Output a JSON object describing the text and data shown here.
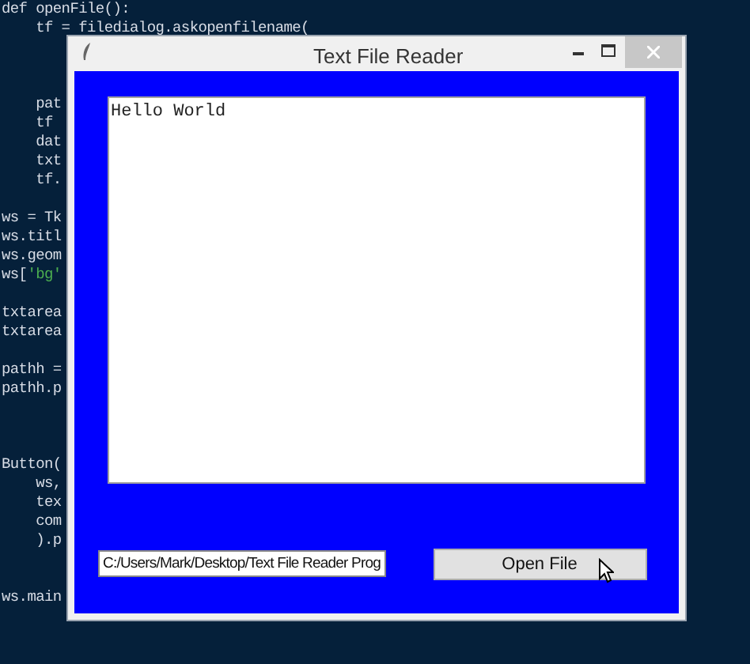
{
  "editor": {
    "lines": [
      {
        "text": "def openFile():"
      },
      {
        "text": "    tf = filedialog.askopenfilename("
      },
      {
        "text": "    pat"
      },
      {
        "text": "    tf "
      },
      {
        "text": "    dat"
      },
      {
        "text": "    txt"
      },
      {
        "text": "    tf."
      },
      {
        "text": "ws = Tk"
      },
      {
        "text": "ws.titl"
      },
      {
        "text": "ws.geom"
      },
      {
        "text": "ws['bg'"
      },
      {
        "text": "txtarea"
      },
      {
        "text": "txtarea"
      },
      {
        "text": "pathh ="
      },
      {
        "text": "pathh.p"
      },
      {
        "text": "Button("
      },
      {
        "text": "    ws,"
      },
      {
        "text": "    tex"
      },
      {
        "text": "    com"
      },
      {
        "text": "    ).p"
      },
      {
        "text": "ws.main"
      }
    ]
  },
  "window": {
    "title": "Text File Reader",
    "text_area": {
      "value": "Hello World"
    },
    "path_field": {
      "value": "C:/Users/Mark/Desktop/Text File Reader Prog"
    },
    "open_button": {
      "label": "Open File"
    }
  }
}
